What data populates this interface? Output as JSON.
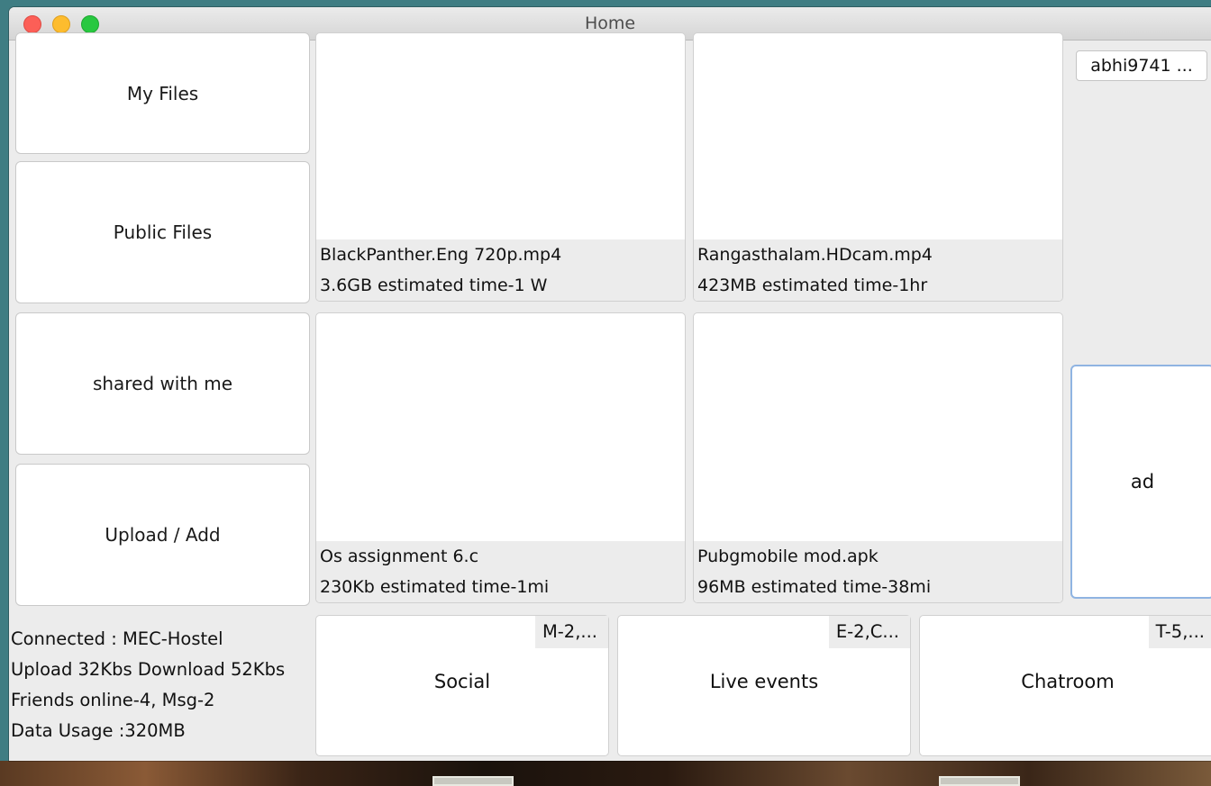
{
  "window": {
    "title": "Home"
  },
  "nav": {
    "my_files": "My Files",
    "public_files": "Public Files",
    "shared_with_me": "shared with me",
    "upload_add": "Upload / Add"
  },
  "files": [
    {
      "name": "BlackPanther.Eng 720p.mp4",
      "info": "3.6GB estimated time-1 W"
    },
    {
      "name": "Rangasthalam.HDcam.mp4",
      "info": "423MB estimated time-1hr"
    },
    {
      "name": "Os assignment 6.c",
      "info": "230Kb estimated time-1mi"
    },
    {
      "name": "Pubgmobile mod.apk",
      "info": "96MB estimated time-38mi"
    }
  ],
  "user": {
    "name": "abhi9741 ..."
  },
  "ad": {
    "label": "ad"
  },
  "status": {
    "connected": "Connected : MEC-Hostel",
    "speed": "Upload 32Kbs Download 52Kbs",
    "friends": "Friends online-4, Msg-2",
    "data_usage": "Data Usage :320MB"
  },
  "sections": [
    {
      "label": "Social",
      "badge": "M-2,..."
    },
    {
      "label": "Live events",
      "badge": "E-2,C..."
    },
    {
      "label": "Chatroom",
      "badge": "T-5,..."
    }
  ]
}
